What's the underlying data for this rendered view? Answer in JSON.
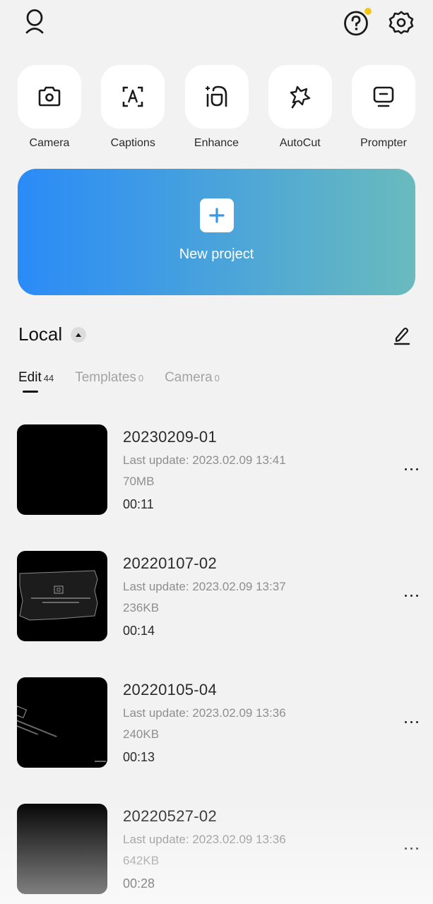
{
  "topbar": {
    "profile_icon": "person-icon",
    "help_icon": "question-circle-icon",
    "settings_icon": "gear-icon",
    "help_has_notification": true
  },
  "colors": {
    "background": "#f2f2f2",
    "notification_dot": "#f5c518",
    "new_project_gradient_start": "#2a8bf8",
    "new_project_gradient_end": "#69bbbd",
    "plus_color": "#3b97e6",
    "text_primary": "#1a1a1a",
    "text_secondary": "#8e8e8e"
  },
  "quick_actions": [
    {
      "label": "Camera",
      "icon": "camera-icon"
    },
    {
      "label": "Captions",
      "icon": "captions-icon"
    },
    {
      "label": "Enhance",
      "icon": "enhance-icon"
    },
    {
      "label": "AutoCut",
      "icon": "magic-wand-star-icon"
    },
    {
      "label": "Prompter",
      "icon": "teleprompter-monitor-icon"
    }
  ],
  "new_project": {
    "label": "New project",
    "icon": "plus-icon"
  },
  "local": {
    "title": "Local",
    "collapse_icon": "caret-up-icon",
    "edit_icon": "pencil-icon"
  },
  "tabs": [
    {
      "label": "Edit",
      "count": "44",
      "active": true
    },
    {
      "label": "Templates",
      "count": "0",
      "active": false
    },
    {
      "label": "Camera",
      "count": "0",
      "active": false
    }
  ],
  "projects": [
    {
      "name": "20230209-01",
      "last_update": "Last update: 2023.02.09 13:41",
      "size": "70MB",
      "duration": "00:11"
    },
    {
      "name": "20220107-02",
      "last_update": "Last update: 2023.02.09 13:37",
      "size": "236KB",
      "duration": "00:14"
    },
    {
      "name": "20220105-04",
      "last_update": "Last update: 2023.02.09 13:36",
      "size": "240KB",
      "duration": "00:13"
    },
    {
      "name": "20220527-02",
      "last_update": "Last update: 2023.02.09 13:36",
      "size": "642KB",
      "duration": "00:28"
    }
  ]
}
